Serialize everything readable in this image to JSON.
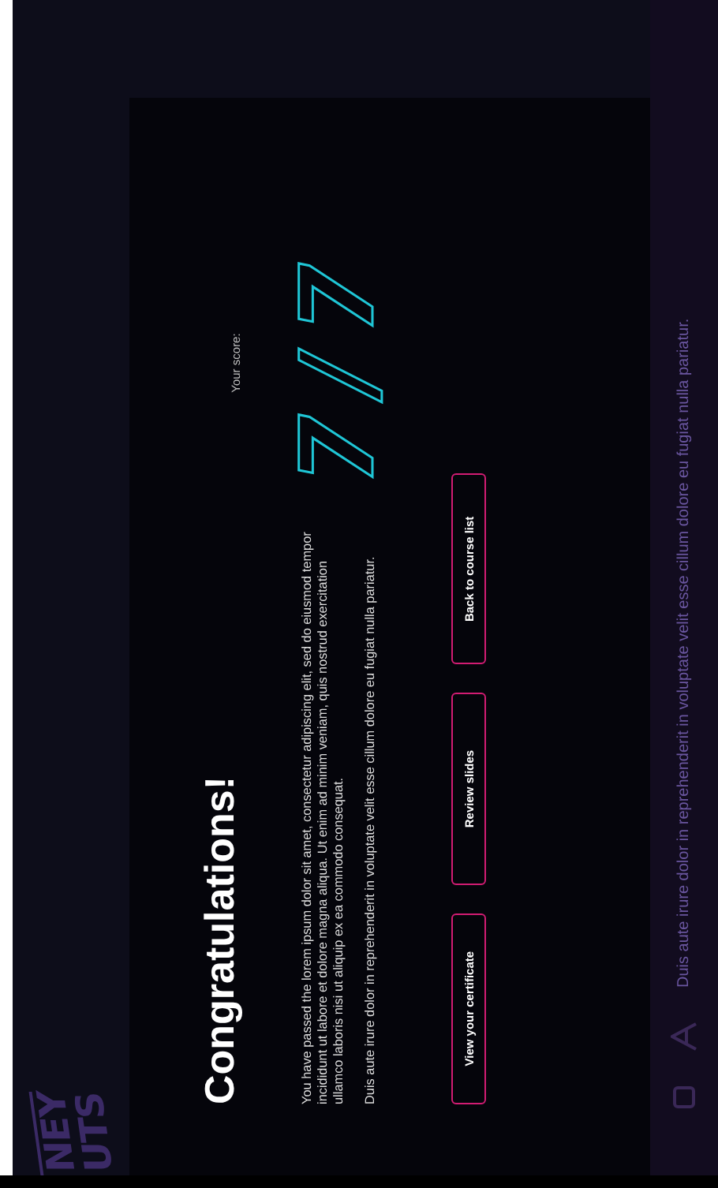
{
  "logo": {
    "lines": [
      "NEY",
      "UTS"
    ]
  },
  "result": {
    "title": "Congratulations!",
    "paragraphs": [
      "You have passed the lorem ipsum dolor sit amet, consectetur adipiscing elit, sed do eiusmod tempor incididunt ut labore et dolore magna aliqua. Ut enim ad minim veniam, quis nostrud exercitation ullamco laboris nisi ut aliquip ex ea commodo consequat.",
      "Duis aute irure dolor in reprehenderit in voluptate velit esse cillum dolore eu fugiat nulla pariatur."
    ],
    "buttons": [
      "View your certificate",
      "Review slides",
      "Back to course list"
    ],
    "score_label": "Your score:",
    "score": "7/7"
  },
  "footer": {
    "text": "Duis aute irure dolor in reprehenderit in voluptate velit esse cillum dolore eu fugiat nulla pariatur."
  }
}
